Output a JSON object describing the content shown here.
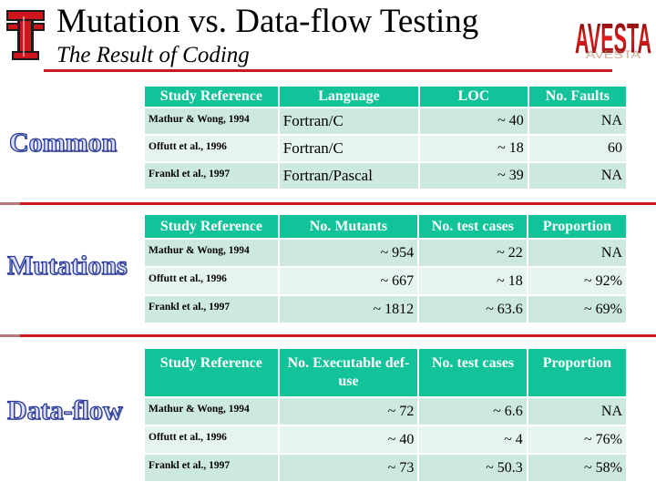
{
  "header": {
    "title": "Mutation vs. Data-flow Testing",
    "subtitle": "The Result of Coding",
    "logo_left": "texas-tech-double-t-logo",
    "logo_right": "AVESTA"
  },
  "colors": {
    "accent_red": "#c8191c",
    "table_header": "#12c39a",
    "row_dark": "#cde9df",
    "row_light": "#e6f4ef",
    "section_label_fill": "#d8dcf4",
    "section_label_stroke": "#2b3a9a"
  },
  "sections": {
    "common": {
      "label": "Common",
      "headers": [
        "Study Reference",
        "Language",
        "LOC",
        "No. Faults"
      ],
      "rows": [
        [
          "Mathur & Wong, 1994",
          "Fortran/C",
          "~ 40",
          "NA"
        ],
        [
          "Offutt et al., 1996",
          "Fortran/C",
          "~ 18",
          "60"
        ],
        [
          "Frankl et al., 1997",
          "Fortran/Pascal",
          "~ 39",
          "NA"
        ]
      ]
    },
    "mutations": {
      "label": "Mutations",
      "headers": [
        "Study Reference",
        "No. Mutants",
        "No. test cases",
        "Proportion"
      ],
      "rows": [
        [
          "Mathur & Wong, 1994",
          "~ 954",
          "~ 22",
          "NA"
        ],
        [
          "Offutt et al., 1996",
          "~ 667",
          "~ 18",
          "~ 92%"
        ],
        [
          "Frankl et al., 1997",
          "~ 1812",
          "~ 63.6",
          "~ 69%"
        ]
      ]
    },
    "dataflow": {
      "label": "Data-flow",
      "headers": [
        "Study Reference",
        "No. Executable def-use",
        "No. test cases",
        "Proportion"
      ],
      "rows": [
        [
          "Mathur & Wong, 1994",
          "~ 72",
          "~ 6.6",
          "NA"
        ],
        [
          "Offutt et al., 1996",
          "~ 40",
          "~ 4",
          "~ 76%"
        ],
        [
          "Frankl et al., 1997",
          "~ 73",
          "~ 50.3",
          "~ 58%"
        ]
      ]
    }
  }
}
